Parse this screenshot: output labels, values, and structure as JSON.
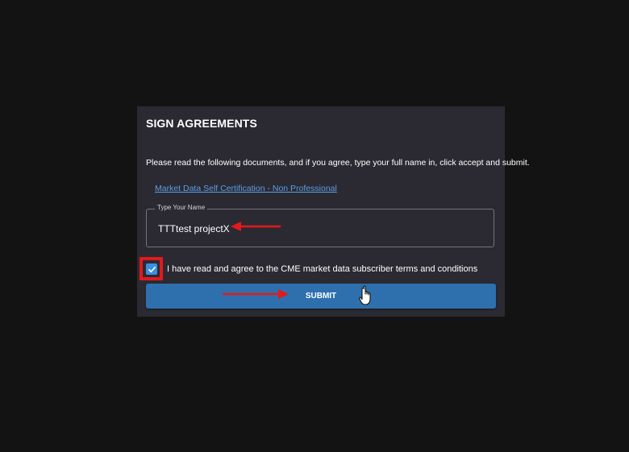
{
  "dialog": {
    "title": "SIGN AGREEMENTS",
    "instructions": "Please read the following documents, and if you agree, type your full name in, click accept and submit.",
    "document_link": "Market Data Self Certification - Non Professional",
    "name_field": {
      "label": "Type Your Name",
      "value": "TTTtest projectX"
    },
    "agreement": {
      "checked": true,
      "label": "I have read and agree to the CME market data subscriber terms and conditions"
    },
    "submit_label": "SUBMIT"
  },
  "colors": {
    "page_background": "#131313",
    "dialog_background": "#2b2a33",
    "link": "#5b9ee6",
    "checkbox": "#3b8fe0",
    "submit_button": "#2e70ad",
    "annotation_red": "#e3191b"
  },
  "icons": {
    "checkbox_mark": "checkmark-icon",
    "annotations": [
      "red-arrow-icon",
      "red-highlight-box",
      "hand-pointer-cursor-icon"
    ]
  }
}
